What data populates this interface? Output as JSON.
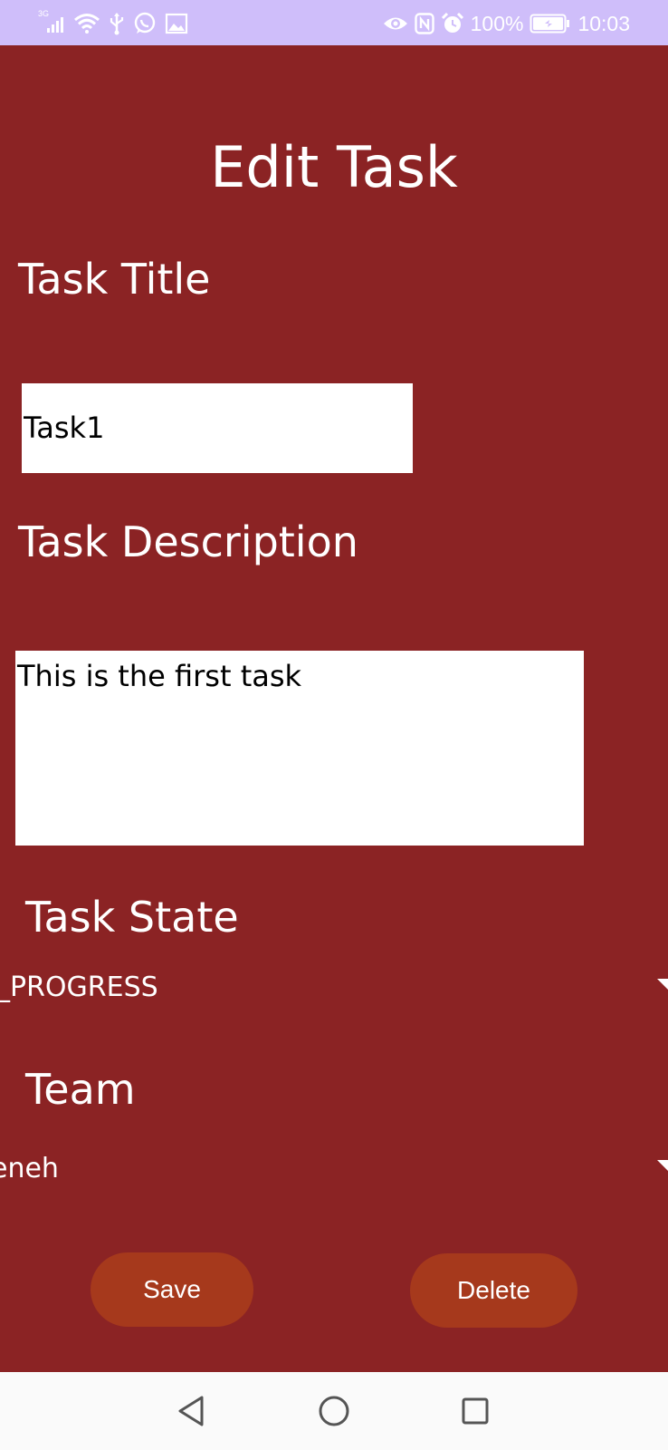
{
  "status_bar": {
    "network_label": "3G",
    "battery": "100%",
    "time": "10:03",
    "icons_left": [
      "signal-icon",
      "wifi-icon",
      "usb-icon",
      "whatsapp-icon",
      "gallery-icon"
    ],
    "icons_right": [
      "eye-icon",
      "nfc-icon",
      "alarm-icon",
      "battery-icon"
    ]
  },
  "page": {
    "title": "Edit Task"
  },
  "form": {
    "task_title_label": "Task Title",
    "task_title_value": "Task1",
    "task_description_label": "Task Description",
    "task_description_value": "This is the first task",
    "task_state_label": "Task State",
    "task_state_value": "_PROGRESS",
    "team_label": "Team",
    "team_value": "eneh"
  },
  "actions": {
    "save_label": "Save",
    "delete_label": "Delete"
  },
  "nav_bar": {
    "buttons": [
      "back-icon",
      "home-icon",
      "recents-icon"
    ]
  },
  "colors": {
    "status_bar": "#CFBEFA",
    "background": "#8B2324",
    "button": "#A6391C",
    "nav_bar": "#FAFAFA"
  }
}
